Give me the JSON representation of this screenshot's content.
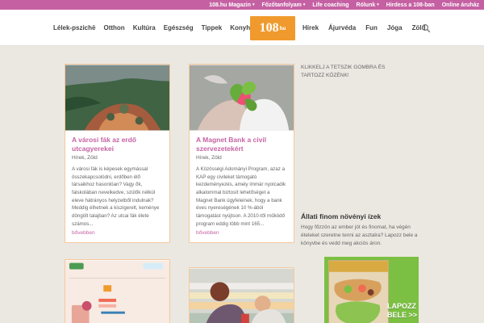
{
  "topbar": {
    "items": [
      {
        "label": "108.hu Magazin",
        "has_caret": true
      },
      {
        "label": "Főzőtanfolyam",
        "has_caret": true
      },
      {
        "label": "Life coaching",
        "has_caret": false
      },
      {
        "label": "Rólunk",
        "has_caret": true
      },
      {
        "label": "Hirdess a 108-ban",
        "has_caret": false
      },
      {
        "label": "Online áruház",
        "has_caret": false
      }
    ]
  },
  "header": {
    "nav_left": [
      "Lélek-pszichë",
      "Otthon",
      "Kultúra",
      "Egészség",
      "Tippek",
      "Konyha"
    ],
    "logo": {
      "main": "108",
      "sub": "hu",
      "small_text": "MAGAZIN"
    },
    "nav_right": [
      "Hírek",
      "Ájurvéda",
      "Fun",
      "Jóga",
      "Zöld"
    ],
    "search_icon": "search-icon"
  },
  "cards": [
    {
      "title": "A városi fák az erdő utcagyerekei",
      "categories": "Hírek, Zöld",
      "excerpt": "A városi fák is képesek egymással összekapcsolódni, erdőben élő társaikhoz hasonlóan? Vagy ők, falskolában nevelkedve, szülők nélkül eleve hátrányos helyzetből indulnak? Meddig élhetnek a kiszigerelt, keménye döngölt talajban? Az utcai fák élete számos...",
      "more": "bővebben"
    },
    {
      "title": "A Magnet Bank a civil szervezetekért",
      "categories": "Hírek, Zöld",
      "excerpt": "A Közösségi Adományi Program, azaz a KAP egy civileket támogató kezdeményezés, amely immár nyolcadik alkalommal biztosít lehetőséget a Magnet Bank ügyfeleinek, hogy a bank éves nyereségének 10 %-ából támogatást nyújtson. A 2010-től működő program eddig több mint 165...",
      "more": "bővebben"
    },
    {
      "title": "",
      "categories": "",
      "excerpt": "",
      "more": ""
    },
    {
      "title": "",
      "categories": "",
      "excerpt": "",
      "more": ""
    }
  ],
  "sidebar": {
    "invite": "KLIKKELJ A TETSZIK GOMBRA ÉS TARTOZZ KÖZÉNK!",
    "promo_title": "Állati finom növényi ízek",
    "promo_body": "Hogy főzzön az ember jót és finomat, ha végén ételeket szeretne tenni az asztalra? Lapozz bele a könyvbe és vedd meg akciós áron.",
    "book_label": "LAPOZZ BELE >>"
  },
  "colors": {
    "brand_pink": "#c561a3",
    "logo_orange": "#f09a2d",
    "book_green": "#7bc043",
    "card_border": "#f5c89b"
  }
}
